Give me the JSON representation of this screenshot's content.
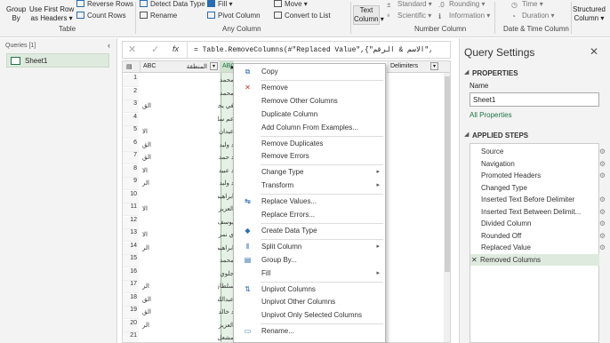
{
  "ribbon": {
    "group_by": [
      "Group",
      "By"
    ],
    "use_first_row": [
      "Use First Row",
      "as Headers"
    ],
    "reverse_rows": "Reverse Rows",
    "count_rows": "Count Rows",
    "group_table": "Table",
    "detect_data_type": "Detect Data Type",
    "rename": "Rename",
    "fill": "Fill",
    "pivot_column": "Pivot Column",
    "move": "Move",
    "convert_to_list": "Convert to List",
    "group_any_column": "Any Column",
    "text_column": [
      "Text",
      "Column"
    ],
    "standard": "Standard",
    "scientific": "Scientific",
    "rounding": "Rounding",
    "information": "Information",
    "group_number_column": "Number Column",
    "time": "Time",
    "duration": "Duration",
    "group_date_time": "Date & Time Column",
    "structured_column": [
      "Structured",
      "Column"
    ]
  },
  "queries": {
    "header": "Queries [1]",
    "items": [
      "Sheet1"
    ]
  },
  "formula_bar": {
    "fx": "fx",
    "formula": "= Table.RemoveColumns(#\"Replaced Value\",{\"الاسم & الرقم\","
  },
  "grid": {
    "col1_header": "المنطقة",
    "col2_header": "ABC",
    "col3_header": "Delimiters",
    "rows": [
      {
        "n": "1",
        "a": "",
        "b": "محمد"
      },
      {
        "n": "2",
        "a": "",
        "b": "محمد"
      },
      {
        "n": "3",
        "a": "الق",
        "b": "في يحيى"
      },
      {
        "n": "4",
        "a": "",
        "b": "عم سالم"
      },
      {
        "n": "5",
        "a": "الا",
        "b": "عيدان"
      },
      {
        "n": "6",
        "a": "الق",
        "b": "د وليد"
      },
      {
        "n": "7",
        "a": "الق",
        "b": "د حمد"
      },
      {
        "n": "8",
        "a": "الا",
        "b": "د عبيد"
      },
      {
        "n": "9",
        "a": "الر",
        "b": "د وليد"
      },
      {
        "n": "10",
        "a": "",
        "b": "ابراهيم"
      },
      {
        "n": "11",
        "a": "الا",
        "b": "العزيز"
      },
      {
        "n": "12",
        "a": "",
        "b": "يوسف"
      },
      {
        "n": "13",
        "a": "الا",
        "b": "ي نمر"
      },
      {
        "n": "14",
        "a": "الر",
        "b": "ابراهيم"
      },
      {
        "n": "15",
        "a": "",
        "b": "محمد"
      },
      {
        "n": "16",
        "a": "",
        "b": "جلوي"
      },
      {
        "n": "17",
        "a": "الر",
        "b": "سلطان"
      },
      {
        "n": "18",
        "a": "الق",
        "b": "عبدالله"
      },
      {
        "n": "19",
        "a": "الق",
        "b": "د خالد"
      },
      {
        "n": "20",
        "a": "الر",
        "b": "العزيز"
      },
      {
        "n": "21",
        "a": "",
        "b": "مشعل"
      }
    ]
  },
  "context_menu": {
    "items": [
      {
        "label": "Copy",
        "icon": "copy-icon",
        "glyph": "⧉",
        "arrow": false
      },
      {
        "sep": true
      },
      {
        "label": "Remove",
        "icon": "remove-icon",
        "glyph": "✕",
        "arrow": false
      },
      {
        "label": "Remove Other Columns",
        "icon": "",
        "glyph": "",
        "arrow": false
      },
      {
        "label": "Duplicate Column",
        "icon": "",
        "glyph": "",
        "arrow": false
      },
      {
        "label": "Add Column From Examples...",
        "icon": "",
        "glyph": "",
        "arrow": false
      },
      {
        "sep": true
      },
      {
        "label": "Remove Duplicates",
        "icon": "",
        "glyph": "",
        "arrow": false
      },
      {
        "label": "Remove Errors",
        "icon": "",
        "glyph": "",
        "arrow": false
      },
      {
        "sep": true
      },
      {
        "label": "Change Type",
        "icon": "",
        "glyph": "",
        "arrow": true
      },
      {
        "label": "Transform",
        "icon": "",
        "glyph": "",
        "arrow": true
      },
      {
        "sep": true
      },
      {
        "label": "Replace Values...",
        "icon": "replace-values-icon",
        "glyph": "↹",
        "arrow": false
      },
      {
        "label": "Replace Errors...",
        "icon": "",
        "glyph": "",
        "arrow": false
      },
      {
        "sep": true
      },
      {
        "label": "Create Data Type",
        "icon": "data-type-icon",
        "glyph": "◆",
        "arrow": false
      },
      {
        "sep": true
      },
      {
        "label": "Split Column",
        "icon": "split-column-icon",
        "glyph": "⫴",
        "arrow": true
      },
      {
        "label": "Group By...",
        "icon": "group-by-icon",
        "glyph": "▤",
        "arrow": false
      },
      {
        "label": "Fill",
        "icon": "",
        "glyph": "",
        "arrow": true
      },
      {
        "sep": true
      },
      {
        "label": "Unpivot Columns",
        "icon": "unpivot-icon",
        "glyph": "⇅",
        "arrow": false
      },
      {
        "label": "Unpivot Other Columns",
        "icon": "",
        "glyph": "",
        "arrow": false
      },
      {
        "label": "Unpivot Only Selected Columns",
        "icon": "",
        "glyph": "",
        "arrow": false
      },
      {
        "sep": true
      },
      {
        "label": "Rename...",
        "icon": "rename-icon",
        "glyph": "▭",
        "arrow": false
      }
    ]
  },
  "query_settings": {
    "title": "Query Settings",
    "properties_label": "PROPERTIES",
    "name_label": "Name",
    "name_value": "Sheet1",
    "all_properties": "All Properties",
    "applied_steps_label": "APPLIED STEPS",
    "steps": [
      {
        "label": "Source",
        "gear": true
      },
      {
        "label": "Navigation",
        "gear": true
      },
      {
        "label": "Promoted Headers",
        "gear": true
      },
      {
        "label": "Changed Type",
        "gear": false
      },
      {
        "label": "Inserted Text Before Delimiter",
        "gear": true
      },
      {
        "label": "Inserted Text Between Delimit...",
        "gear": true
      },
      {
        "label": "Divided Column",
        "gear": true
      },
      {
        "label": "Rounded Off",
        "gear": true
      },
      {
        "label": "Replaced Value",
        "gear": true
      },
      {
        "label": "Removed Columns",
        "gear": false,
        "active": true
      }
    ]
  },
  "colors": {
    "accent_green": "#217346",
    "selected_step": "#dfeadf",
    "selected_col": "#e6f1e6"
  }
}
